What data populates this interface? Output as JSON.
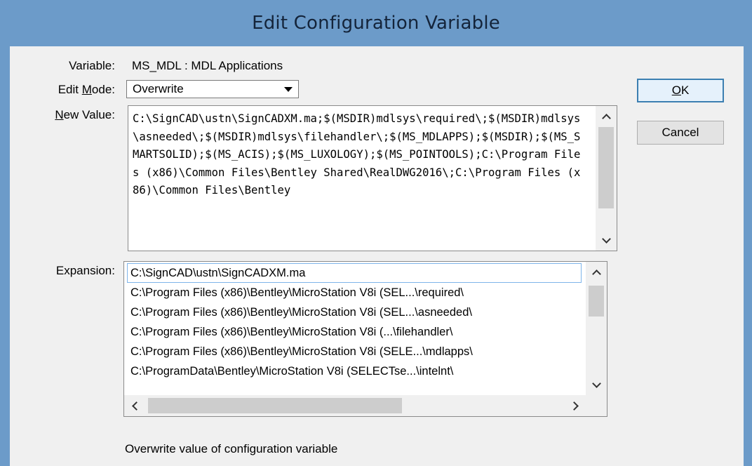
{
  "window": {
    "title": "Edit Configuration Variable"
  },
  "variable": {
    "label": "Variable:",
    "value": "MS_MDL : MDL Applications"
  },
  "edit_mode": {
    "label_pre": "Edit ",
    "label_ul": "M",
    "label_post": "ode:",
    "selected": "Overwrite"
  },
  "new_value": {
    "label_ul": "N",
    "label_post": "ew Value:",
    "text": "C:\\SignCAD\\ustn\\SignCADXM.ma;$(MSDIR)mdlsys\\required\\;$(MSDIR)mdlsys\\asneeded\\;$(MSDIR)mdlsys\\filehandler\\;$(MS_MDLAPPS);$(MSDIR);$(MS_SMARTSOLID);$(MS_ACIS);$(MS_LUXOLOGY);$(MS_POINTOOLS);C:\\Program Files (x86)\\Common Files\\Bentley Shared\\RealDWG2016\\;C:\\Program Files (x86)\\Common Files\\Bentley"
  },
  "expansion": {
    "label": "Expansion:",
    "items": [
      "C:\\SignCAD\\ustn\\SignCADXM.ma",
      "C:\\Program Files (x86)\\Bentley\\MicroStation V8i (SEL...\\required\\",
      "C:\\Program Files (x86)\\Bentley\\MicroStation V8i (SEL...\\asneeded\\",
      "C:\\Program Files (x86)\\Bentley\\MicroStation V8i (...\\filehandler\\",
      "C:\\Program Files (x86)\\Bentley\\MicroStation V8i (SELE...\\mdlapps\\",
      "C:\\ProgramData\\Bentley\\MicroStation V8i (SELECTse...\\intelnt\\"
    ]
  },
  "buttons": {
    "ok_ul": "O",
    "ok_post": "K",
    "cancel": "Cancel"
  },
  "status": "Overwrite value of configuration variable"
}
